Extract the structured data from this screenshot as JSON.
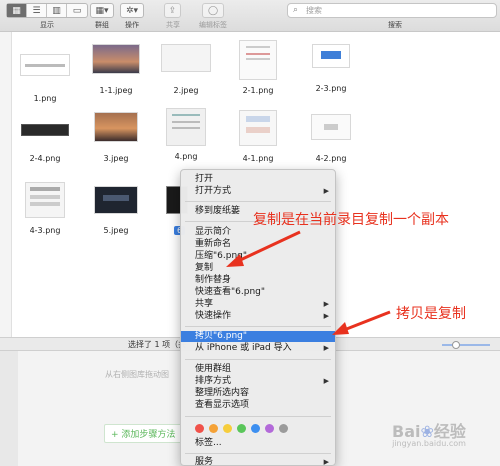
{
  "toolbar": {
    "view_label": "显示",
    "group_label": "群组",
    "action_label": "操作",
    "share_label": "共享",
    "edit_tags_label": "编辑标签",
    "search_placeholder": "搜索",
    "search_label": "搜索"
  },
  "files": [
    {
      "name": "1.png"
    },
    {
      "name": "1-1.jpeg"
    },
    {
      "name": "2.jpeg"
    },
    {
      "name": "2-1.png"
    },
    {
      "name": "2-3.png"
    },
    {
      "name": "2-4.png"
    },
    {
      "name": "3.jpeg"
    },
    {
      "name": "4.png"
    },
    {
      "name": "4-1.png"
    },
    {
      "name": "4-2.png"
    },
    {
      "name": "4-3.png"
    },
    {
      "name": "5.jpeg"
    },
    {
      "name": "6"
    }
  ],
  "status": {
    "selection_text": "选择了 1 项（共"
  },
  "background_page": {
    "hint": "从右侧图库拖动图",
    "add_step": "+ 添加步骤方法"
  },
  "menu": {
    "items": [
      {
        "label": "打开",
        "submenu": false
      },
      {
        "label": "打开方式",
        "submenu": true
      },
      {
        "label": "移到废纸篓",
        "submenu": false
      },
      {
        "label": "显示简介",
        "submenu": false
      },
      {
        "label": "重新命名",
        "submenu": false
      },
      {
        "label": "压缩\"6.png\"",
        "submenu": false
      },
      {
        "label": "复制",
        "submenu": false
      },
      {
        "label": "制作替身",
        "submenu": false
      },
      {
        "label": "快速查看\"6.png\"",
        "submenu": false
      },
      {
        "label": "共享",
        "submenu": true
      },
      {
        "label": "快速操作",
        "submenu": true
      },
      {
        "label": "拷贝\"6.png\"",
        "submenu": false,
        "selected": true
      },
      {
        "label": "从 iPhone 或 iPad 导入",
        "submenu": true
      },
      {
        "label": "使用群组",
        "submenu": false
      },
      {
        "label": "排序方式",
        "submenu": true
      },
      {
        "label": "整理所选内容",
        "submenu": false
      },
      {
        "label": "查看显示选项",
        "submenu": false
      },
      {
        "label": "标签...",
        "submenu": false
      },
      {
        "label": "服务",
        "submenu": true
      }
    ],
    "tag_colors": [
      "#f0524a",
      "#f5a237",
      "#f6cd3c",
      "#5ac65a",
      "#3d8ff0",
      "#b36ad9",
      "#9b9b9b"
    ]
  },
  "annotations": {
    "copy_note": "复制是在当前录目复制一个副本",
    "duplicate_note": "拷贝是复制"
  },
  "watermark": {
    "brand": "Baidu 经验",
    "sub": "jingyan.baidu.com"
  }
}
